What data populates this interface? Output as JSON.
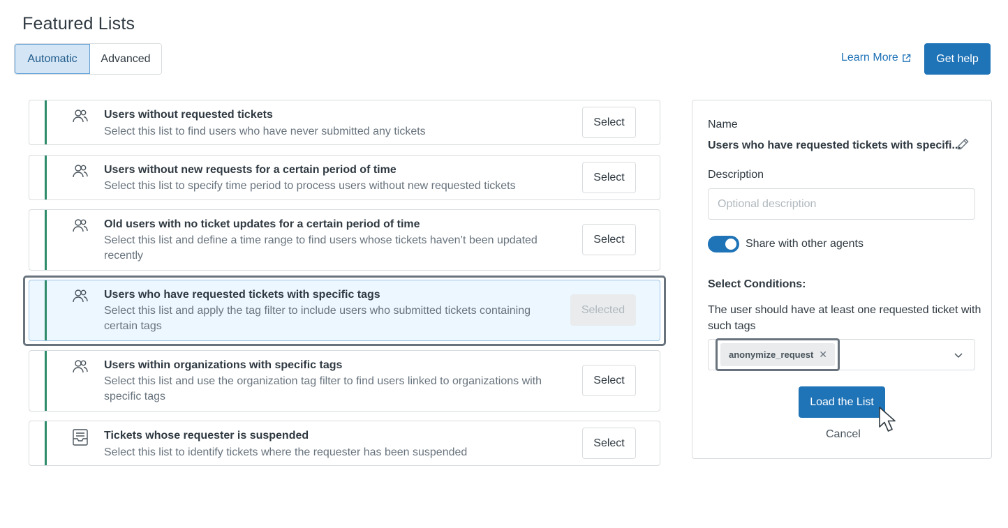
{
  "page": {
    "title": "Featured Lists"
  },
  "mode_tabs": [
    {
      "label": "Automatic",
      "active": true
    },
    {
      "label": "Advanced",
      "active": false
    }
  ],
  "header_actions": {
    "learn_more": "Learn More",
    "get_help": "Get help"
  },
  "lists": [
    {
      "title": "Users without requested tickets",
      "description": "Select this list to find users who have never submitted any tickets",
      "button": "Select",
      "icon": "users-icon",
      "selected": false
    },
    {
      "title": "Users without new requests for a certain period of time",
      "description": "Select this list to specify time period to process users without new requested tickets",
      "button": "Select",
      "icon": "users-icon",
      "selected": false
    },
    {
      "title": "Old users with no ticket updates for a certain period of time",
      "description": "Select this list and define a time range to find users whose tickets haven’t been updated recently",
      "button": "Select",
      "icon": "users-icon",
      "selected": false
    },
    {
      "title": "Users who have requested tickets with specific tags",
      "description": "Select this list and apply the tag filter to include users who submitted tickets containing certain tags",
      "button": "Selected",
      "icon": "users-icon",
      "selected": true
    },
    {
      "title": "Users within organizations with specific tags",
      "description": "Select this list and use the organization tag filter to find users linked to organizations with specific tags",
      "button": "Select",
      "icon": "users-icon",
      "selected": false
    },
    {
      "title": "Tickets whose requester is suspended",
      "description": "Select this list to identify tickets where the requester has been suspended",
      "button": "Select",
      "icon": "inbox-icon",
      "selected": false
    }
  ],
  "panel": {
    "name_label": "Name",
    "name_value": "Users who have requested tickets with specifi...",
    "description_label": "Description",
    "description_placeholder": "Optional description",
    "share_label": "Share with other agents",
    "share_enabled": true,
    "conditions_title": "Select Conditions:",
    "conditions_text": "The user should have at least one requested ticket with such tags",
    "tags": [
      "anonymize_request"
    ],
    "load_button": "Load the List",
    "cancel": "Cancel"
  },
  "colors": {
    "primary": "#1f73b7",
    "accent_bar": "#2e8b6a",
    "selected_bg": "#edf7ff"
  }
}
